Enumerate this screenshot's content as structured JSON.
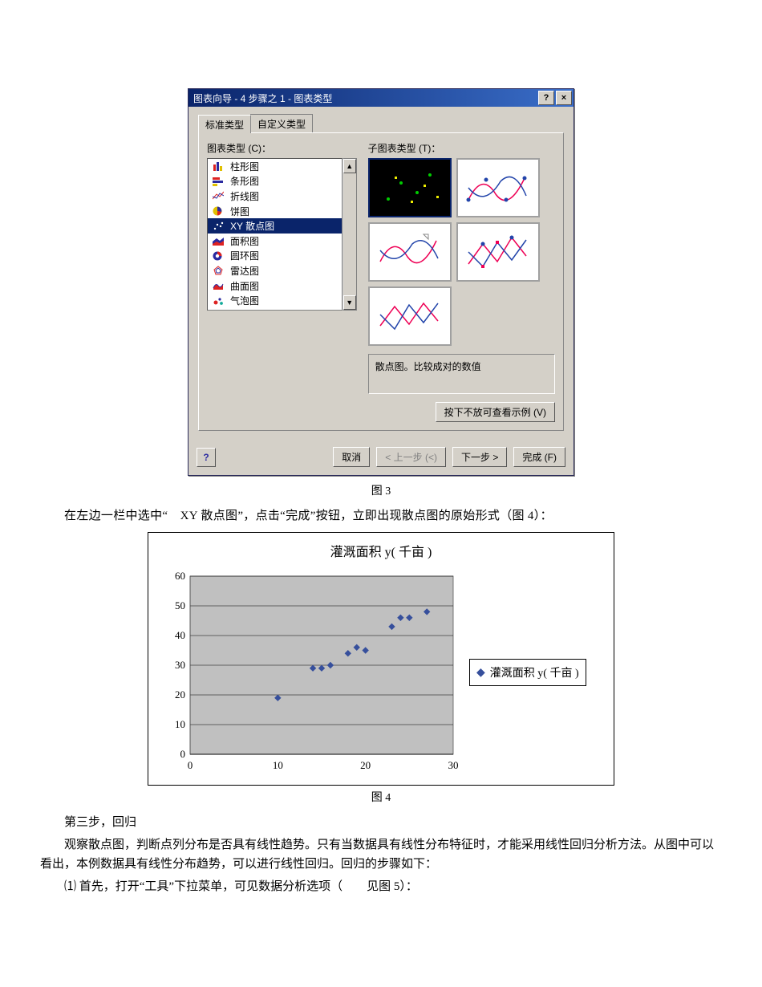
{
  "dialog": {
    "title": "图表向导 - 4 步骤之 1 - 图表类型",
    "help_btn": "?",
    "close_btn": "×",
    "tabs": {
      "standard": "标准类型",
      "custom": "自定义类型"
    },
    "chart_type_label": "图表类型 (C)：",
    "sub_type_label": "子图表类型 (T)：",
    "chart_types": [
      {
        "label": "柱形图"
      },
      {
        "label": "条形图"
      },
      {
        "label": "折线图"
      },
      {
        "label": "饼图"
      },
      {
        "label": "XY 散点图",
        "selected": true
      },
      {
        "label": "面积图"
      },
      {
        "label": "圆环图"
      },
      {
        "label": "雷达图"
      },
      {
        "label": "曲面图"
      },
      {
        "label": "气泡图"
      }
    ],
    "description": "散点图。比较成对的数值",
    "preview_button": "按下不放可查看示例 (V)",
    "footer": {
      "help": "?",
      "cancel": "取消",
      "back": "< 上一步 (<)",
      "next": "下一步 >",
      "finish": "完成 (F)"
    },
    "scroll_up": "▲",
    "scroll_down": "▼"
  },
  "captions": {
    "fig3": "图 3",
    "fig4": "图 4"
  },
  "paragraphs": {
    "p1": "在左边一栏中选中“　XY 散点图”，点击“完成”按钮，立即出现散点图的原始形式（图 4）：",
    "p_step3": "第三步，回归",
    "p2": "观察散点图，判断点列分布是否具有线性趋势。只有当数据具有线性分布特征时，才能采用线性回归分析方法。从图中可以看出，本例数据具有线性分布趋势，可以进行线性回归。回归的步骤如下：",
    "p3": "⑴ 首先，打开“工具”下拉菜单，可见数据分析选项（　　见图 5）："
  },
  "chart_data": {
    "type": "scatter",
    "title": "灌溉面积 y( 千亩 )",
    "series": [
      {
        "name": "灌溉面积 y( 千亩 )",
        "points": [
          {
            "x": 10,
            "y": 19
          },
          {
            "x": 14,
            "y": 29
          },
          {
            "x": 15,
            "y": 29
          },
          {
            "x": 16,
            "y": 30
          },
          {
            "x": 18,
            "y": 34
          },
          {
            "x": 19,
            "y": 36
          },
          {
            "x": 20,
            "y": 35
          },
          {
            "x": 23,
            "y": 43
          },
          {
            "x": 24,
            "y": 46
          },
          {
            "x": 25,
            "y": 46
          },
          {
            "x": 27,
            "y": 48
          }
        ]
      }
    ],
    "xlim": [
      0,
      30
    ],
    "ylim": [
      0,
      60
    ],
    "xticks": [
      0,
      10,
      20,
      30
    ],
    "yticks": [
      0,
      10,
      20,
      30,
      40,
      50,
      60
    ],
    "xlabel": "",
    "ylabel": ""
  }
}
